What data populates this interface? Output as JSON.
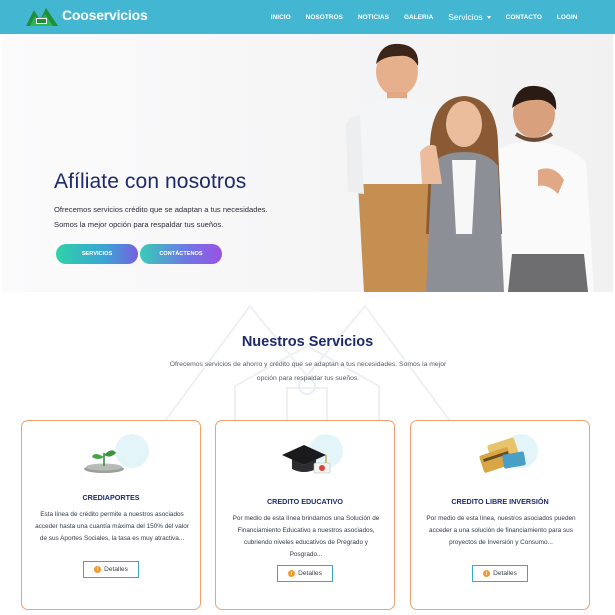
{
  "nav": {
    "brand": "Cooservicios",
    "links": [
      "INICIO",
      "NOSOTROS",
      "NOTICIAS",
      "GALERIA",
      "Servicios",
      "CONTACTO",
      "LOGIN"
    ]
  },
  "hero": {
    "title": "Afíliate con nosotros",
    "line1": "Ofrecemos servicios crédito que se adaptan a tus necesidades.",
    "line2": "Somos la mejor opción para respaldar tus sueños.",
    "btn_services": "SERVICIOS",
    "btn_contact": "CONTÁCTENOS"
  },
  "services": {
    "title": "Nuestros Servicios",
    "subtitle": "Ofrecemos servicios de ahorro y crédito que se adaptan a tus necesidades. Somos la mejor opción para respaldar tus sueños.",
    "cards": [
      {
        "title": "CREDIAPORTES",
        "text": "Esta línea de crédito permite a nuestros asociados acceder hasta una cuantía máxima del 150% del valor de sus Aportes Sociales, la tasa es muy atractiva...",
        "button": "Detalles",
        "icon": "money-plant-icon"
      },
      {
        "title": "CREDITO EDUCATIVO",
        "text": "Por medio de esta línea brindamos una Solución de Financiamiento Educativo a nuestros asociados, cubriendo niveles educativos de Pregrado y Posgrado...",
        "button": "Detalles",
        "icon": "graduation-cap-icon"
      },
      {
        "title": "CREDITO LIBRE INVERSIÓN",
        "text": "Por medio de esta línea, nuestros asociados pueden acceder a una solución de financiamiento para sus proyectos de Inversión y Consumo...",
        "button": "Detalles",
        "icon": "credit-cards-icon"
      }
    ]
  },
  "colors": {
    "navbar": "#43b6d2",
    "title_navy": "#1e2a6b",
    "card_border": "#f3a06d",
    "detail_border": "#3aa7c4",
    "info_orange": "#f29a2e"
  }
}
